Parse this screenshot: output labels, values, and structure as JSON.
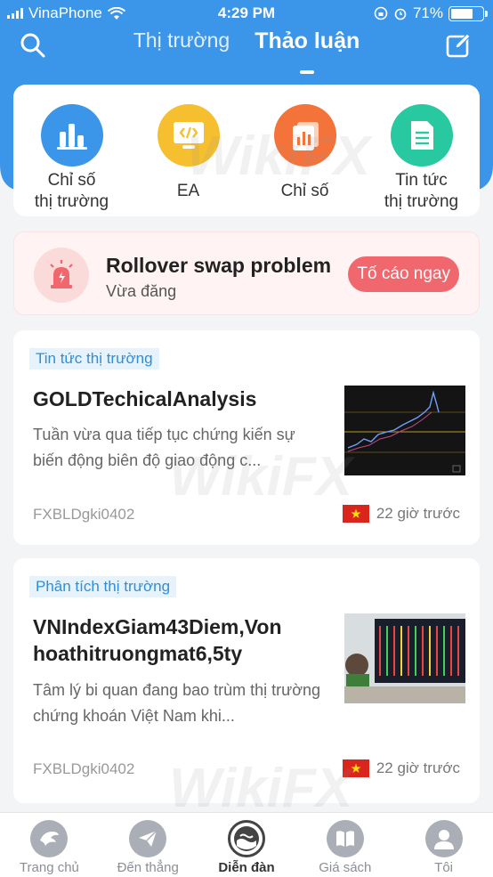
{
  "status_bar": {
    "carrier": "VinaPhone",
    "time": "4:29 PM",
    "battery": "71%"
  },
  "header": {
    "tabs": [
      {
        "label": "Thị trường",
        "active": false
      },
      {
        "label": "Thảo luận",
        "active": true
      }
    ]
  },
  "shortcuts": [
    {
      "label": "Chỉ số\nthị trường",
      "icon": "bar-chart-icon",
      "color": "#3b95e8"
    },
    {
      "label": "EA",
      "icon": "code-monitor-icon",
      "color": "#f5bf2f"
    },
    {
      "label": "Chỉ số",
      "icon": "document-chart-icon",
      "color": "#f4733b"
    },
    {
      "label": "Tin tức\nthị trường",
      "icon": "news-document-icon",
      "color": "#28c8a0"
    }
  ],
  "alert": {
    "title": "Rollover swap problem",
    "subtitle": "Vừa đăng",
    "button": "Tố cáo ngay",
    "icon": "siren-icon"
  },
  "articles": [
    {
      "tag": "Tin tức thị trường",
      "title": "GOLDTechicalAnalysis",
      "description": "Tuần vừa qua tiếp tục chứng kiến sự biến động biên độ giao động c...",
      "author": "FXBLDgki0402",
      "time": "22 giờ trước"
    },
    {
      "tag": "Phân tích thị trường",
      "title": "VNIndexGiam43Diem,Von hoathitruongmat6,5ty",
      "description": "Tâm lý bi quan đang bao trùm thị trường chứng khoán Việt Nam khi...",
      "author": "FXBLDgki0402",
      "time": "22 giờ trước"
    }
  ],
  "bottom_nav": [
    {
      "label": "Trang chủ",
      "icon": "home-eagle-icon",
      "active": false
    },
    {
      "label": "Đến thẳng",
      "icon": "paper-plane-icon",
      "active": false
    },
    {
      "label": "Diễn đàn",
      "icon": "forum-icon",
      "active": true
    },
    {
      "label": "Giá sách",
      "icon": "book-icon",
      "active": false
    },
    {
      "label": "Tôi",
      "icon": "user-icon",
      "active": false
    }
  ],
  "colors": {
    "header_blue": "#3b95e8",
    "alert_red": "#f0686e",
    "tag_blue": "#2f8ed8"
  },
  "watermark": "WikiFX"
}
